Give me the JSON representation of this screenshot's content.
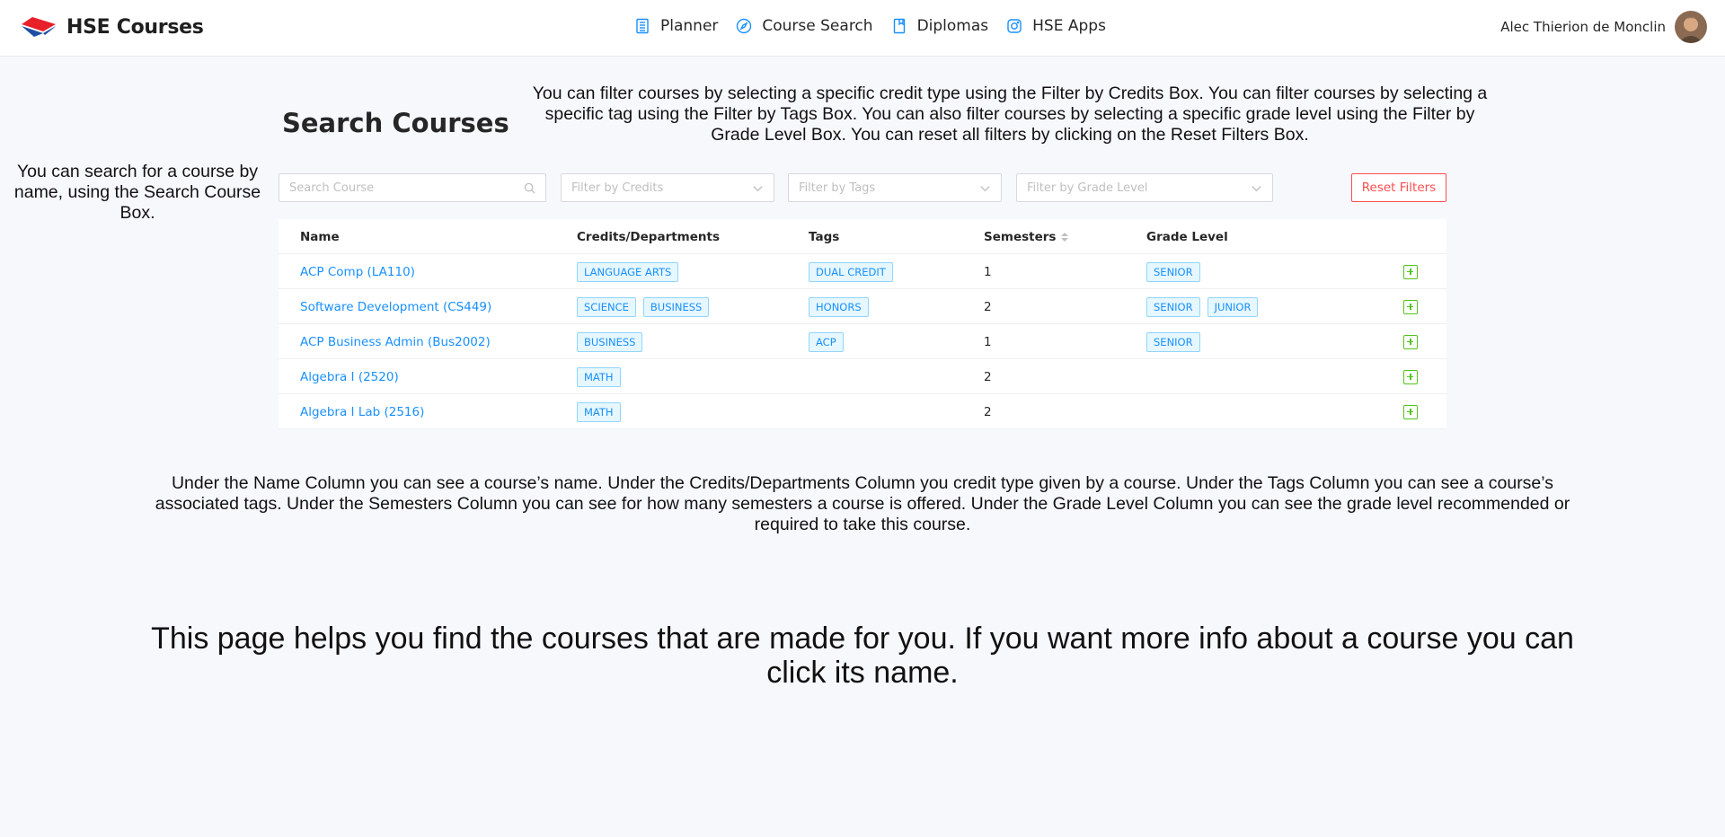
{
  "app": {
    "title": "HSE Courses"
  },
  "nav": [
    {
      "label": "Planner",
      "icon": "planner-icon"
    },
    {
      "label": "Course Search",
      "icon": "compass-icon"
    },
    {
      "label": "Diplomas",
      "icon": "book-icon"
    },
    {
      "label": "HSE Apps",
      "icon": "instagram-icon"
    }
  ],
  "user": {
    "name": "Alec Thierion de Monclin"
  },
  "page": {
    "title": "Search Courses"
  },
  "annotations": {
    "filter": "You can filter courses by selecting a specific credit type using the Filter by Credits Box. You can filter courses by selecting a specific tag using the Filter by Tags Box. You can also filter courses by selecting a specific grade level using the Filter by Grade Level Box. You can reset all filters by clicking on the Reset Filters Box.",
    "search": "You can search for a course by name, using the Search Course Box.",
    "columns": "Under the Name Column you can see a course’s name. Under the Credits/Departments Column you credit type given by a course. Under the Tags Column you can see a course’s associated tags. Under the Semesters Column you can see for how many semesters a course is offered. Under the Grade Level Column you can see the grade level recommended or required to take this course.",
    "main": "This page helps you find the courses that are made for you. If you want more info about a course you can click its name."
  },
  "filters": {
    "search_placeholder": "Search Course",
    "credits_placeholder": "Filter by Credits",
    "tags_placeholder": "Filter by Tags",
    "grade_placeholder": "Filter by Grade Level",
    "reset_label": "Reset Filters"
  },
  "table": {
    "headers": {
      "name": "Name",
      "credits": "Credits/Departments",
      "tags": "Tags",
      "semesters": "Semesters",
      "grade": "Grade Level"
    },
    "rows": [
      {
        "name": "ACP Comp (LA110)",
        "credits": [
          "LANGUAGE ARTS"
        ],
        "tags": [
          "DUAL CREDIT"
        ],
        "semesters": "1",
        "grades": [
          "SENIOR"
        ]
      },
      {
        "name": "Software Development (CS449)",
        "credits": [
          "SCIENCE",
          "BUSINESS"
        ],
        "tags": [
          "HONORS"
        ],
        "semesters": "2",
        "grades": [
          "SENIOR",
          "JUNIOR"
        ]
      },
      {
        "name": "ACP Business Admin (Bus2002)",
        "credits": [
          "BUSINESS"
        ],
        "tags": [
          "ACP"
        ],
        "semesters": "1",
        "grades": [
          "SENIOR"
        ]
      },
      {
        "name": "Algebra I (2520)",
        "credits": [
          "MATH"
        ],
        "tags": [],
        "semesters": "2",
        "grades": []
      },
      {
        "name": "Algebra I Lab (2516)",
        "credits": [
          "MATH"
        ],
        "tags": [],
        "semesters": "2",
        "grades": []
      }
    ]
  },
  "colors": {
    "accent": "#1890ff",
    "danger": "#ff4d4f",
    "success": "#52c41a",
    "brand_red": "#e8202a",
    "brand_blue": "#1d4fa3"
  }
}
